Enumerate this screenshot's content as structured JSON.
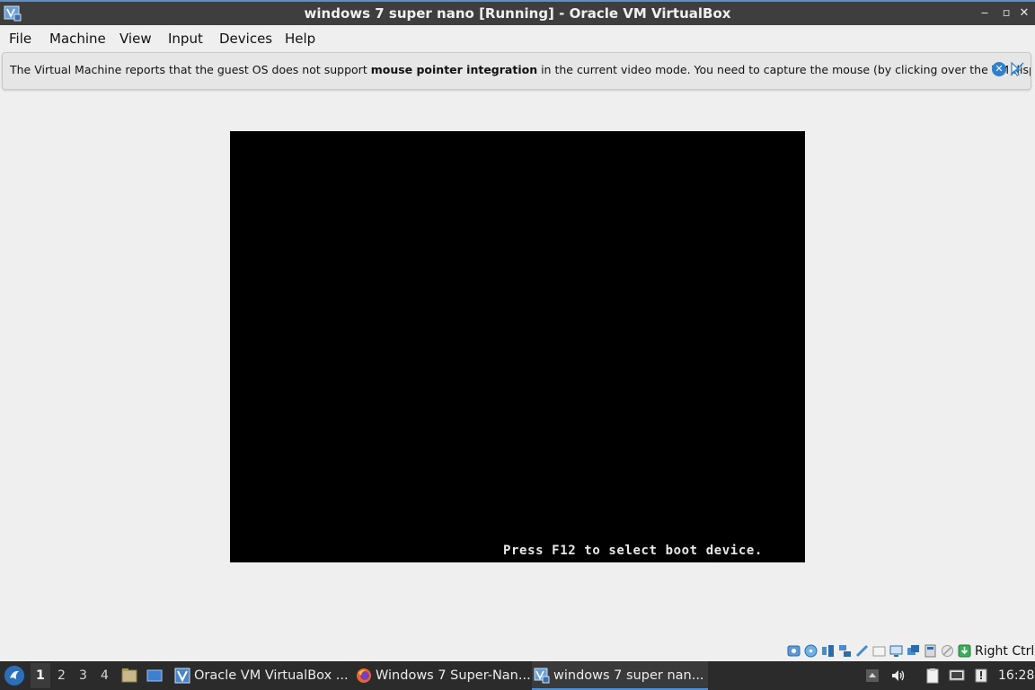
{
  "window": {
    "title": "windows 7 super nano [Running] - Oracle VM VirtualBox",
    "app_icon": "virtualbox-vm-icon",
    "controls": {
      "minimize": "‒",
      "maximize": "▫",
      "close": "✕"
    }
  },
  "menubar": {
    "items": [
      "File",
      "Machine",
      "View",
      "Input",
      "Devices",
      "Help"
    ]
  },
  "notice": {
    "text_before": "The Virtual Machine reports that the guest OS does not support ",
    "text_bold": "mouse pointer integration",
    "text_after": " in the current video mode. You need to capture the mouse (by clicking over the VM display",
    "close_symbol": "✕"
  },
  "vm_screen": {
    "boot_message": "Press F12 to select boot device."
  },
  "statusbar": {
    "icons": [
      "hard-disk-icon",
      "optical-drive-icon",
      "audio-icon",
      "network-icon",
      "usb-icon",
      "shared-folders-icon",
      "display-icon",
      "video-capture-icon",
      "cpu-icon",
      "mouse-integration-icon",
      "keyboard-capture-icon"
    ],
    "host_key": "Right Ctrl"
  },
  "taskbar": {
    "workspaces": [
      "1",
      "2",
      "3",
      "4"
    ],
    "active_workspace": "1",
    "tasks": [
      {
        "label": "Oracle VM VirtualBox ...",
        "icon": "virtualbox-icon",
        "active": false
      },
      {
        "label": "Windows 7 Super-Nan...",
        "icon": "firefox-icon",
        "active": false
      },
      {
        "label": "windows 7 super nan...",
        "icon": "virtualbox-vm-icon",
        "active": true
      }
    ],
    "clock": "16:28",
    "colors": {
      "accent": "#4c8fd6",
      "taskbar_bg": "#2b2b2b"
    }
  }
}
